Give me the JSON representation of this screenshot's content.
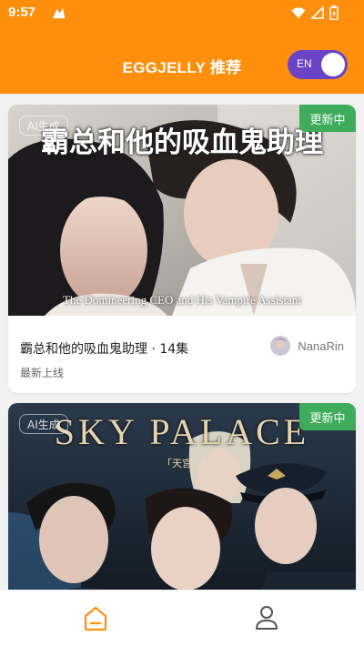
{
  "status_bar": {
    "time": "9:57",
    "icons": [
      "app-notification-icon",
      "wifi-icon",
      "signal-icon",
      "battery-icon"
    ]
  },
  "header": {
    "title": "EGGJELLY 推荐",
    "language_toggle": {
      "label": "EN",
      "on": true
    }
  },
  "feed": [
    {
      "cover_title_cn": "霸总和他的吸血鬼助理",
      "cover_title_en": "The Domineering CEO and His Vampire Assistant",
      "badge_update": "更新中",
      "badge_ai": "AI生成",
      "title": "霸总和他的吸血鬼助理 · 14集",
      "subtitle": "最新上线",
      "author": "NanaRin"
    },
    {
      "cover_title": "SKY PALACE",
      "cover_subtitle": "「天宫」",
      "badge_update": "更新中",
      "badge_ai": "AI生成"
    }
  ],
  "bottom_nav": {
    "items": [
      {
        "icon": "home-icon",
        "active": true
      },
      {
        "icon": "profile-icon",
        "active": false
      }
    ]
  },
  "colors": {
    "header_orange": "#fd8f0d",
    "toggle_purple": "#6a43c7",
    "update_green": "#3fac5b",
    "nav_active": "#fd8f0d"
  }
}
